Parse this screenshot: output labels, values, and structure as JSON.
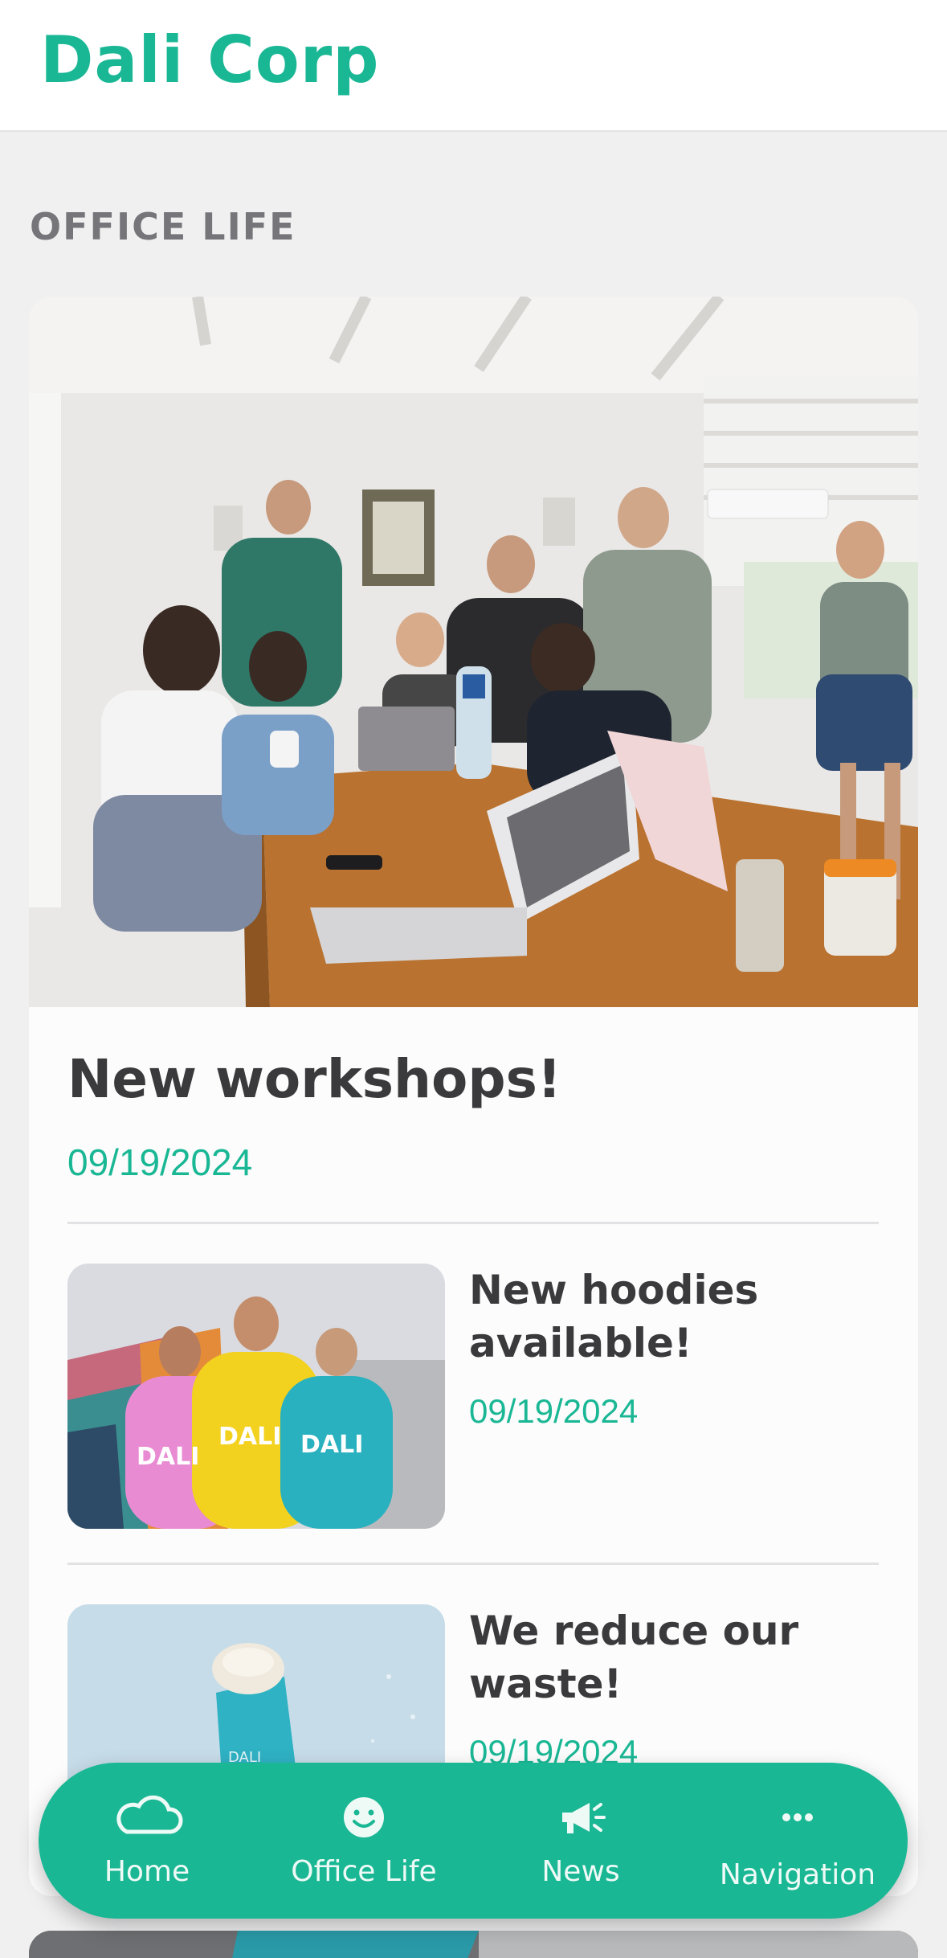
{
  "header": {
    "brand": "Dali Corp"
  },
  "section": {
    "title": "OFFICE LIFE"
  },
  "featured": {
    "title": "New workshops!",
    "date": "09/19/2024"
  },
  "items": [
    {
      "title": "New hoodies available!",
      "date": "09/19/2024"
    },
    {
      "title": "We reduce our waste!",
      "date": "09/19/2024"
    }
  ],
  "tabs": [
    {
      "label": "Home",
      "icon": "cloud-icon"
    },
    {
      "label": "Office Life",
      "icon": "smiley-icon"
    },
    {
      "label": "News",
      "icon": "megaphone-icon"
    },
    {
      "label": "Navigation",
      "icon": "more-dots-icon"
    }
  ],
  "colors": {
    "accent": "#1ab795",
    "text": "#3a3a3c",
    "section": "#76767a",
    "background": "#f0f0f1"
  }
}
